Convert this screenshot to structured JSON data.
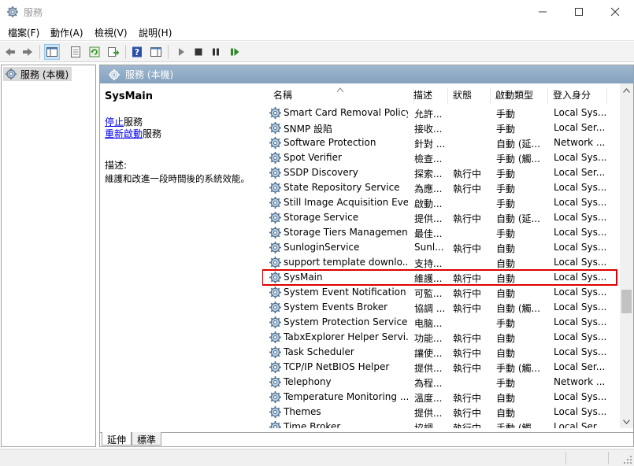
{
  "window": {
    "title": "服務",
    "app_icon": "gear-icon",
    "controls": [
      "minimize-icon",
      "maximize-icon",
      "close-icon"
    ]
  },
  "menu": [
    "檔案(F)",
    "動作(A)",
    "檢視(V)",
    "說明(H)"
  ],
  "toolbar": {
    "icons": [
      "back-arrow-icon",
      "forward-arrow-icon",
      "show-tree-icon",
      "properties-icon",
      "refresh-icon",
      "export-list-icon",
      "help-icon",
      "action-pane-icon",
      "start-icon",
      "stop-icon",
      "pause-icon",
      "restart-icon"
    ]
  },
  "tree": {
    "root_label": "服務 (本機)"
  },
  "main": {
    "header_label": "服務 (本機)",
    "selected_service": "SysMain",
    "action_stop_link": "停止",
    "action_stop_suffix": "服務",
    "action_restart_link": "重新啟動",
    "action_restart_suffix": "服務",
    "desc_label": "描述:",
    "desc_text": "維護和改進一段時間後的系統效能。"
  },
  "columns": [
    "名稱",
    "描述",
    "狀態",
    "啟動類型",
    "登入身分"
  ],
  "rows": [
    {
      "name": "Smart Card Removal Policy",
      "desc": "允許...",
      "status": "",
      "start": "手動",
      "logon": "Local Sys..."
    },
    {
      "name": "SNMP 設陷",
      "desc": "接收...",
      "status": "",
      "start": "手動",
      "logon": "Local Ser..."
    },
    {
      "name": "Software Protection",
      "desc": "針對 ...",
      "status": "",
      "start": "自動 (延...",
      "logon": "Network ..."
    },
    {
      "name": "Spot Verifier",
      "desc": "檢查...",
      "status": "",
      "start": "手動 (觸...",
      "logon": "Local Sys..."
    },
    {
      "name": "SSDP Discovery",
      "desc": "探索...",
      "status": "執行中",
      "start": "手動",
      "logon": "Local Ser..."
    },
    {
      "name": "State Repository Service",
      "desc": "為應...",
      "status": "執行中",
      "start": "手動",
      "logon": "Local Sys..."
    },
    {
      "name": "Still Image Acquisition Eve...",
      "desc": "啟動...",
      "status": "",
      "start": "手動",
      "logon": "Local Sys..."
    },
    {
      "name": "Storage Service",
      "desc": "提供...",
      "status": "執行中",
      "start": "自動 (延...",
      "logon": "Local Sys..."
    },
    {
      "name": "Storage Tiers Management",
      "desc": "最佳...",
      "status": "",
      "start": "手動",
      "logon": "Local Sys..."
    },
    {
      "name": "SunloginService",
      "desc": "Sunl...",
      "status": "執行中",
      "start": "自動",
      "logon": "Local Sys..."
    },
    {
      "name": "support template downlo...",
      "desc": "支持...",
      "status": "",
      "start": "自動",
      "logon": "Local Sys..."
    },
    {
      "name": "SysMain",
      "desc": "維護...",
      "status": "執行中",
      "start": "自動",
      "logon": "Local Sys...",
      "selected": true
    },
    {
      "name": "System Event Notification ...",
      "desc": "可監...",
      "status": "執行中",
      "start": "自動",
      "logon": "Local Sys..."
    },
    {
      "name": "System Events Broker",
      "desc": "協調 ...",
      "status": "執行中",
      "start": "自動 (觸...",
      "logon": "Local Sys..."
    },
    {
      "name": "System Protection Service",
      "desc": "电脑...",
      "status": "",
      "start": "手動",
      "logon": "Local Sys..."
    },
    {
      "name": "TabxExplorer Helper Servi...",
      "desc": "功能...",
      "status": "執行中",
      "start": "自動",
      "logon": "Local Sys..."
    },
    {
      "name": "Task Scheduler",
      "desc": "讓使...",
      "status": "執行中",
      "start": "自動",
      "logon": "Local Sys..."
    },
    {
      "name": "TCP/IP NetBIOS Helper",
      "desc": "提供...",
      "status": "執行中",
      "start": "手動 (觸...",
      "logon": "Local Ser..."
    },
    {
      "name": "Telephony",
      "desc": "為程...",
      "status": "",
      "start": "手動",
      "logon": "Network ..."
    },
    {
      "name": "Temperature Monitoring ...",
      "desc": "溫度...",
      "status": "執行中",
      "start": "自動",
      "logon": "Local Sys..."
    },
    {
      "name": "Themes",
      "desc": "提供...",
      "status": "執行中",
      "start": "自動",
      "logon": "Local Sys..."
    },
    {
      "name": "Time Broker",
      "desc": "協調 ...",
      "status": "執行中",
      "start": "手動 (觸...",
      "logon": "Local Ser..."
    }
  ],
  "tabs": [
    "延伸",
    "標準"
  ],
  "colors": {
    "selection_outline": "#e00000",
    "header_bg": "#8fa9c3",
    "link": "#0000ee"
  }
}
